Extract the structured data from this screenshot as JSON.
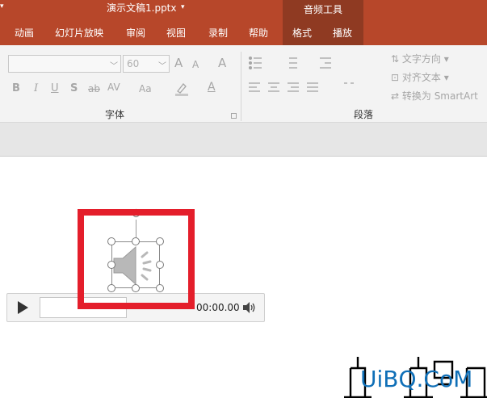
{
  "window": {
    "title": "演示文稿1.pptx",
    "title_dropdown": "▾",
    "quick_access": "▾"
  },
  "context_tab": {
    "label": "音频工具"
  },
  "tabs": [
    {
      "label": "动画"
    },
    {
      "label": "幻灯片放映"
    },
    {
      "label": "审阅"
    },
    {
      "label": "视图"
    },
    {
      "label": "录制"
    },
    {
      "label": "帮助"
    },
    {
      "label": "格式"
    },
    {
      "label": "播放"
    }
  ],
  "ribbon": {
    "font_group": {
      "label": "字体",
      "font_size": "60",
      "buttons": {
        "bold": "B",
        "italic": "I",
        "underline": "U",
        "shadow": "S",
        "strike": "ab",
        "spacing": "AV",
        "case": "Aa",
        "color": "A",
        "grow": "A",
        "shrink": "A"
      }
    },
    "paragraph_group": {
      "label": "段落",
      "text_direction": "文字方向",
      "align_text": "对齐文本",
      "convert_smartart": "转换为 SmartArt"
    }
  },
  "player": {
    "time": "00:00.00"
  },
  "watermark": {
    "text": "UiBQ.CoM"
  },
  "colors": {
    "accent": "#b7472a",
    "context": "#8f3a22",
    "highlight": "#e41e2b"
  }
}
